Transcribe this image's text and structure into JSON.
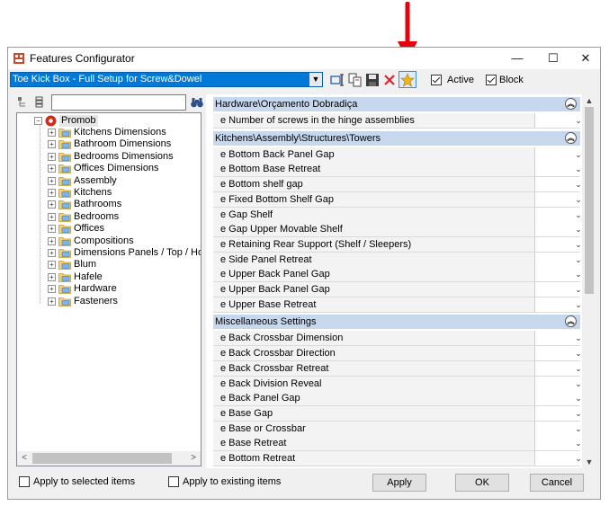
{
  "window": {
    "title": "Features Configurator",
    "minimize_glyph": "—",
    "maximize_glyph": "☐",
    "close_glyph": "✕"
  },
  "toolbar": {
    "setup_value": "Toe Kick Box - Full Setup for Screw&Dowel",
    "icons": [
      "rename-icon",
      "copy-setup-icon",
      "save-icon",
      "delete-icon",
      "star-icon"
    ],
    "active_label": "Active",
    "active_checked": true,
    "block_label": "Block",
    "block_checked": true
  },
  "tree": {
    "root": "Promob",
    "items": [
      "Kitchens Dimensions",
      "Bathroom Dimensions",
      "Bedrooms Dimensions",
      "Offices Dimensions",
      "Assembly",
      "Kitchens",
      "Bathrooms",
      "Bedrooms",
      "Offices",
      "Compositions",
      "Dimensions Panels / Top / Honeycomb",
      "Blum",
      "Hafele",
      "Hardware",
      "Fasteners"
    ]
  },
  "sections": [
    {
      "title": "Hardware\\Orçamento Dobradiça",
      "rows": [
        "e Number of screws in the hinge assemblies"
      ]
    },
    {
      "title": "Kitchens\\Assembly\\Structures\\Towers",
      "rows": [
        "e Bottom Back Panel Gap",
        "e Bottom Base Retreat",
        "e Bottom shelf gap",
        "e Fixed Bottom Shelf Gap",
        "e Gap Shelf",
        "e Gap Upper Movable Shelf",
        "e Retaining Rear Support (Shelf / Sleepers)",
        "e Side Panel Retreat",
        "e Upper Back Panel Gap",
        "e Upper Back Panel Gap",
        "e Upper Base Retreat"
      ]
    },
    {
      "title": "Miscellaneous Settings",
      "rows": [
        "e Back Crossbar Dimension",
        "e Back Crossbar Direction",
        "e Back Crossbar Retreat",
        "e Back Division Reveal",
        "e Back Panel Gap",
        "e Base Gap",
        "e Base or Crossbar",
        "e Base Retreat",
        "e Bottom Retreat"
      ]
    }
  ],
  "bottom": {
    "apply_selected_label": "Apply to selected items",
    "apply_existing_label": "Apply to existing items",
    "apply_button": "Apply",
    "ok_button": "OK",
    "cancel_button": "Cancel"
  },
  "colors": {
    "selection_blue": "#0078d7",
    "section_header": "#c6d7ee",
    "annotation_red": "#e8000b"
  }
}
